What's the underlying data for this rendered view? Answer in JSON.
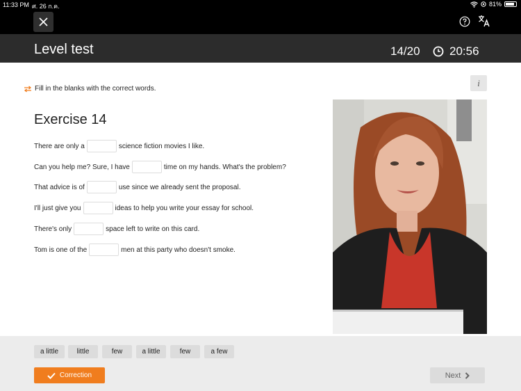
{
  "status_bar": {
    "time": "11:33 PM",
    "date": "ศ. 26 ก.ค.",
    "battery": "81%"
  },
  "header": {
    "title": "Level test",
    "progress": "14/20",
    "timer": "20:56"
  },
  "instruction": "Fill in the blanks with the correct words.",
  "exercise": {
    "title": "Exercise 14",
    "sentences": [
      {
        "before": "There are only a",
        "after": "science fiction movies I like."
      },
      {
        "before": "Can you help me?  Sure, I have",
        "after": "time on my hands. What's the problem?"
      },
      {
        "before": "That advice is of",
        "after": "use since we already sent the proposal."
      },
      {
        "before": "I'll just give you",
        "after": "ideas to help you write your essay for school."
      },
      {
        "before": "There's only",
        "after": "space left to write on this card."
      },
      {
        "before": "Tom is one of the",
        "after": "men at this party who doesn't smoke."
      }
    ]
  },
  "word_bank": [
    "a little",
    "little",
    "few",
    "a little",
    "few",
    "a few"
  ],
  "buttons": {
    "correction": "Correction",
    "next": "Next",
    "info": "i"
  },
  "colors": {
    "accent": "#f07d1e",
    "header_bg": "#2c2c2c",
    "bottom_bg": "#ececec"
  },
  "icons": [
    "close-icon",
    "help-icon",
    "translate-icon",
    "clock-icon",
    "swap-icon",
    "check-icon",
    "chevron-right-icon"
  ]
}
